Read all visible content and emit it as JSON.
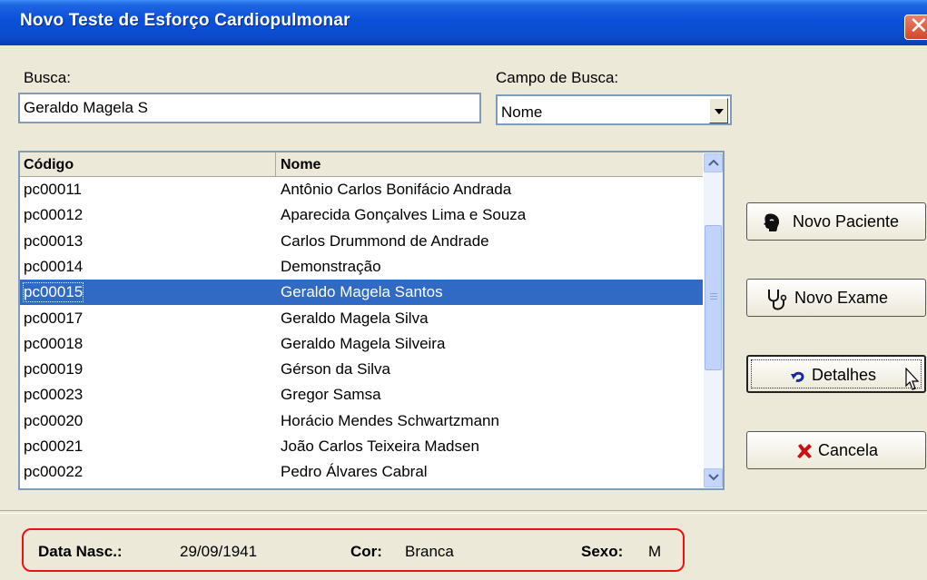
{
  "window": {
    "title": "Novo Teste de Esforço Cardiopulmonar"
  },
  "search": {
    "label": "Busca:",
    "value": "Geraldo Magela S",
    "field_label": "Campo de Busca:",
    "field_value": "Nome"
  },
  "table": {
    "headers": [
      "Código",
      "Nome"
    ],
    "rows": [
      {
        "codigo": "pc00011",
        "nome": "Antônio Carlos Bonifácio Andrada"
      },
      {
        "codigo": "pc00012",
        "nome": "Aparecida Gonçalves Lima e Souza"
      },
      {
        "codigo": "pc00013",
        "nome": "Carlos Drummond de Andrade"
      },
      {
        "codigo": "pc00014",
        "nome": "Demonstração"
      },
      {
        "codigo": "pc00015",
        "nome": "Geraldo Magela Santos"
      },
      {
        "codigo": "pc00017",
        "nome": "Geraldo Magela Silva"
      },
      {
        "codigo": "pc00018",
        "nome": "Geraldo Magela Silveira"
      },
      {
        "codigo": "pc00019",
        "nome": "Gérson da Silva"
      },
      {
        "codigo": "pc00023",
        "nome": "Gregor Samsa"
      },
      {
        "codigo": "pc00020",
        "nome": "Horácio Mendes Schwartzmann"
      },
      {
        "codigo": "pc00021",
        "nome": "João Carlos Teixeira Madsen"
      },
      {
        "codigo": "pc00022",
        "nome": "Pedro Álvares Cabral"
      }
    ],
    "selected_index": 4
  },
  "buttons": {
    "novo_paciente": "Novo Paciente",
    "novo_exame": "Novo Exame",
    "detalhes": "Detalhes",
    "cancela": "Cancela"
  },
  "info": {
    "data_nasc_label": "Data Nasc.:",
    "data_nasc_value": "29/09/1941",
    "cor_label": "Cor:",
    "cor_value": "Branca",
    "sexo_label": "Sexo:",
    "sexo_value": "M"
  },
  "icons": {
    "close": "close-icon",
    "novo_paciente": "patient-head-icon",
    "novo_exame": "stethoscope-icon",
    "detalhes": "undo-arrow-icon",
    "cancela": "red-x-icon"
  },
  "colors": {
    "title_bar": "#0a50d8",
    "selection": "#316ac5",
    "highlight_outline": "#ee1111"
  }
}
